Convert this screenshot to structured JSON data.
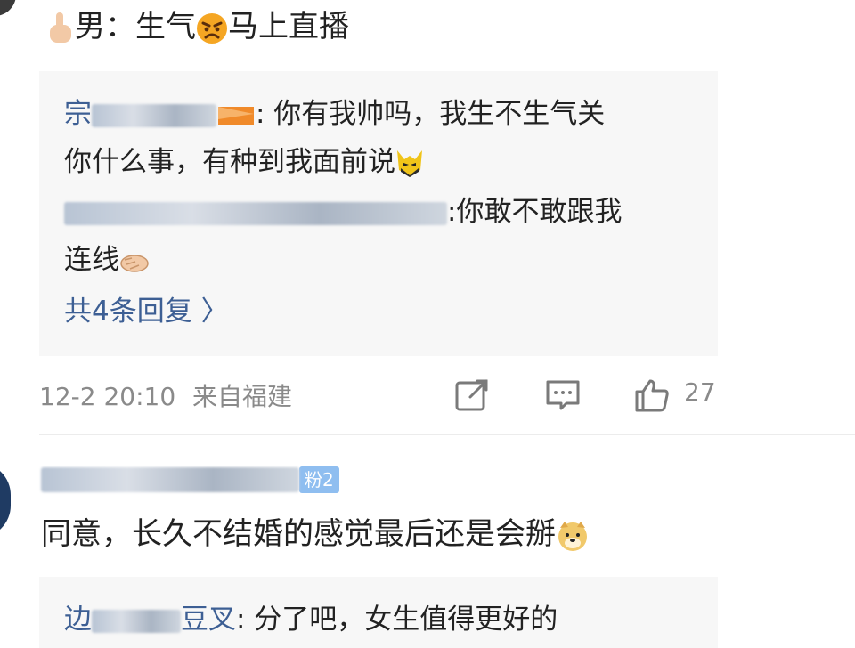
{
  "comment1": {
    "prefix": "男：生气",
    "suffix": "马上直播"
  },
  "reply_box1": {
    "reply1": {
      "username_visible": "宗",
      "text_line1": ": 你有我帅吗，我生不生气关",
      "text_line2": "你什么事，有种到我面前说"
    },
    "reply2": {
      "text_line1": ":你敢不敢跟我",
      "text_line2": "连线"
    },
    "more_replies": "共4条回复 〉"
  },
  "meta": {
    "timestamp": "12-2 20:10",
    "location": "来自福建",
    "likes": "27"
  },
  "comment2": {
    "fan_badge": "粉2",
    "text": "同意，长久不结婚的感觉最后还是会掰"
  },
  "reply_box2": {
    "reply1": {
      "username_visible": "边",
      "username_tail": "豆叉",
      "text": ": 分了吧，女生值得更好的"
    }
  },
  "icons": {
    "c1_lead": "middle-finger-emoji-icon",
    "c1_angry": "angry-face-emoji-icon",
    "wolverine": "wolverine-mask-emoji-icon",
    "wave": "waving-hand-emoji-icon",
    "doge": "doge-emoji-icon",
    "share": "share-icon",
    "comment": "comment-icon",
    "like": "thumbs-up-icon"
  },
  "colors": {
    "link": "#3d5f94",
    "meta": "#8a8a8a",
    "reply_bg": "#f7f7f7"
  }
}
